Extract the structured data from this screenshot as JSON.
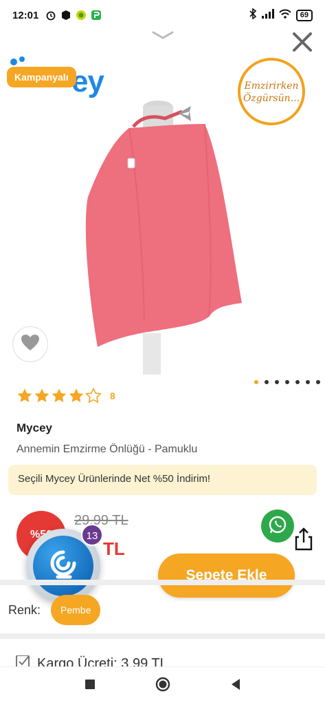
{
  "status_bar": {
    "time": "12:01",
    "battery": "69",
    "icons": [
      "alarm-icon",
      "box-icon",
      "coin-app-icon",
      "green-app-icon",
      "bluetooth-icon",
      "signal-icon",
      "wifi-icon",
      "battery-icon"
    ]
  },
  "hero": {
    "brand_logo": "ey",
    "campaign_badge": "Kampanyalı",
    "stamp_line1": "Emzirirken",
    "stamp_line2": "Özgürsün...",
    "image_count": 7,
    "active_image": 1
  },
  "rating": {
    "stars": 4.5,
    "count": "8"
  },
  "product": {
    "brand": "Mycey",
    "title": "Annemin Emzirme Önlüğü - Pamuklu",
    "promo": "Seçili Mycey Ürünlerinde Net %50 İndirim!",
    "discount": "%50",
    "old_price": "29,99 TL",
    "new_price": "TL"
  },
  "chat": {
    "badge_count": "13"
  },
  "actions": {
    "add_to_cart": "Sepete Ekle"
  },
  "variant": {
    "label": "Renk:",
    "value": "Pembe"
  },
  "shipping": {
    "text": "Kargo Ücreti: 3,99 TL"
  },
  "colors": {
    "accent": "#f5a623",
    "sale_red": "#e53935",
    "whatsapp_green": "#2ea84a",
    "product_pink": "#ee6f7d"
  }
}
